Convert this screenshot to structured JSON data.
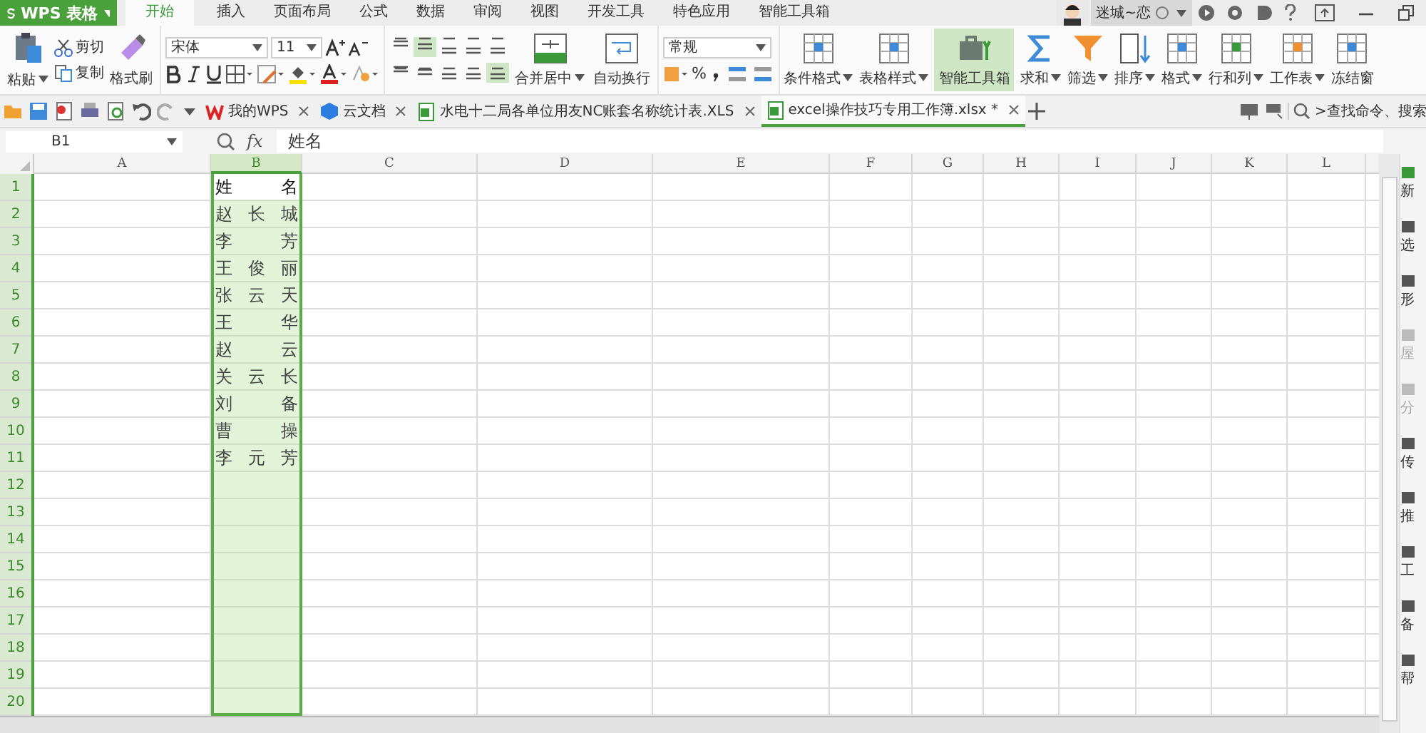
{
  "app_button": {
    "label": "WPS 表格"
  },
  "menu_tabs": [
    {
      "label": "开始",
      "selected": true
    },
    {
      "label": "插入",
      "selected": false
    },
    {
      "label": "页面布局",
      "selected": false
    },
    {
      "label": "公式",
      "selected": false
    },
    {
      "label": "数据",
      "selected": false
    },
    {
      "label": "审阅",
      "selected": false
    },
    {
      "label": "视图",
      "selected": false
    },
    {
      "label": "开发工具",
      "selected": false
    },
    {
      "label": "特色应用",
      "selected": false
    },
    {
      "label": "智能工具箱",
      "selected": false
    }
  ],
  "user": {
    "name": "迷城~恋"
  },
  "ribbon": {
    "clipboard": {
      "paste": "粘贴",
      "cut": "剪切",
      "copy": "复制",
      "format_painter": "格式刷"
    },
    "font": {
      "name": "宋体",
      "size": "11"
    },
    "align_buttons": [
      {
        "selected": false
      },
      {
        "selected": true
      },
      {
        "selected": false
      },
      {
        "selected": false
      },
      {
        "selected": false
      },
      {
        "selected": false
      },
      {
        "selected": false
      },
      {
        "selected": false
      },
      {
        "selected": false
      },
      {
        "selected": true
      }
    ],
    "merge": "合并居中",
    "wrap": "自动换行",
    "number_format": "常规",
    "percent": "%",
    "big_buttons": [
      {
        "label": "条件格式",
        "dropdown": true,
        "highlighted": false
      },
      {
        "label": "表格样式",
        "dropdown": true,
        "highlighted": false
      },
      {
        "label": "智能工具箱",
        "dropdown": false,
        "highlighted": true
      },
      {
        "label": "求和",
        "dropdown": true,
        "highlighted": false
      },
      {
        "label": "筛选",
        "dropdown": true,
        "highlighted": false
      },
      {
        "label": "排序",
        "dropdown": true,
        "highlighted": false
      },
      {
        "label": "格式",
        "dropdown": true,
        "highlighted": false
      },
      {
        "label": "行和列",
        "dropdown": true,
        "highlighted": false
      },
      {
        "label": "工作表",
        "dropdown": true,
        "highlighted": false
      },
      {
        "label": "冻结窗",
        "dropdown": false,
        "highlighted": false
      }
    ]
  },
  "doc_tabs": [
    {
      "label": "我的WPS",
      "selected": false
    },
    {
      "label": "云文档",
      "selected": false
    },
    {
      "label": "水电十二局各单位用友NC账套名称统计表.XLS",
      "selected": false
    },
    {
      "label": "excel操作技巧专用工作簿.xlsx *",
      "selected": true
    }
  ],
  "command_search": {
    "placeholder": ">查找命令、搜索"
  },
  "formula_bar": {
    "name_box": "B1",
    "fx": "fx",
    "value": "姓名"
  },
  "sheet": {
    "columns": [
      {
        "label": "A",
        "selected": false
      },
      {
        "label": "B",
        "selected": true
      },
      {
        "label": "C",
        "selected": false
      },
      {
        "label": "D",
        "selected": false
      },
      {
        "label": "E",
        "selected": false
      },
      {
        "label": "F",
        "selected": false
      },
      {
        "label": "G",
        "selected": false
      },
      {
        "label": "H",
        "selected": false
      },
      {
        "label": "I",
        "selected": false
      },
      {
        "label": "J",
        "selected": false
      },
      {
        "label": "K",
        "selected": false
      },
      {
        "label": "L",
        "selected": false
      }
    ],
    "rows": [
      {
        "label": "1",
        "selected": true
      },
      {
        "label": "2",
        "selected": true
      },
      {
        "label": "3",
        "selected": true
      },
      {
        "label": "4",
        "selected": true
      },
      {
        "label": "5",
        "selected": true
      },
      {
        "label": "6",
        "selected": true
      },
      {
        "label": "7",
        "selected": true
      },
      {
        "label": "8",
        "selected": true
      },
      {
        "label": "9",
        "selected": true
      },
      {
        "label": "10",
        "selected": true
      },
      {
        "label": "11",
        "selected": true
      },
      {
        "label": "12",
        "selected": true
      },
      {
        "label": "13",
        "selected": true
      },
      {
        "label": "14",
        "selected": true
      },
      {
        "label": "15",
        "selected": true
      },
      {
        "label": "16",
        "selected": true
      },
      {
        "label": "17",
        "selected": true
      },
      {
        "label": "18",
        "selected": true
      },
      {
        "label": "19",
        "selected": true
      },
      {
        "label": "20",
        "selected": true
      }
    ],
    "column_b": [
      {
        "text": "姓名",
        "active": true
      },
      {
        "text": "赵长城",
        "active": false
      },
      {
        "text": "李芳",
        "active": false
      },
      {
        "text": "王俊丽",
        "active": false
      },
      {
        "text": "张云天",
        "active": false
      },
      {
        "text": "王华",
        "active": false
      },
      {
        "text": "赵云",
        "active": false
      },
      {
        "text": "关云长",
        "active": false
      },
      {
        "text": "刘备",
        "active": false
      },
      {
        "text": "曹操",
        "active": false
      },
      {
        "text": "李元芳",
        "active": false
      }
    ]
  },
  "side_panel": [
    {
      "label": "新",
      "disabled": false
    },
    {
      "label": "选",
      "disabled": false
    },
    {
      "label": "形",
      "disabled": false
    },
    {
      "label": "屋",
      "disabled": true
    },
    {
      "label": "分",
      "disabled": true
    },
    {
      "label": "传",
      "disabled": false
    },
    {
      "label": "推",
      "disabled": false
    },
    {
      "label": "工",
      "disabled": false
    },
    {
      "label": "备",
      "disabled": false
    },
    {
      "label": "帮",
      "disabled": false
    }
  ]
}
